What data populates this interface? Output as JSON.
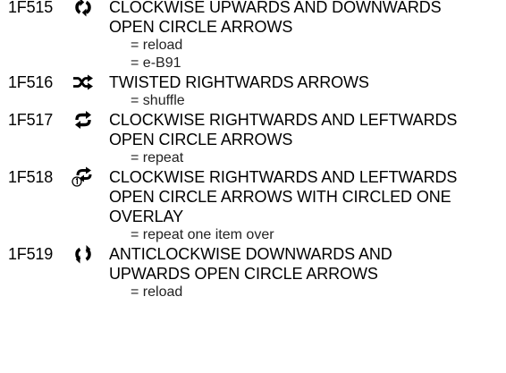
{
  "entries": [
    {
      "code": "1F515",
      "icon": "clockwise-up-down-circle-arrows-icon",
      "name_lines": [
        "CLOCKWISE UPWARDS AND DOWNWARDS",
        "OPEN CIRCLE ARROWS"
      ],
      "notes": [
        "= reload",
        "= e-B91"
      ]
    },
    {
      "code": "1F516",
      "icon": "twisted-rightwards-arrows-icon",
      "name_lines": [
        "TWISTED RIGHTWARDS ARROWS"
      ],
      "notes": [
        "= shuffle"
      ]
    },
    {
      "code": "1F517",
      "icon": "clockwise-right-left-circle-arrows-icon",
      "name_lines": [
        "CLOCKWISE RIGHTWARDS AND LEFTWARDS",
        "OPEN CIRCLE ARROWS"
      ],
      "notes": [
        "= repeat"
      ]
    },
    {
      "code": "1F518",
      "icon": "repeat-one-circle-arrows-icon",
      "name_lines": [
        "CLOCKWISE RIGHTWARDS AND LEFTWARDS",
        "OPEN CIRCLE ARROWS WITH CIRCLED ONE",
        "OVERLAY"
      ],
      "notes": [
        "= repeat one item over"
      ]
    },
    {
      "code": "1F519",
      "icon": "anticlockwise-down-up-circle-arrows-icon",
      "name_lines": [
        "ANTICLOCKWISE DOWNWARDS AND",
        "UPWARDS OPEN CIRCLE ARROWS"
      ],
      "notes": [
        "= reload"
      ]
    }
  ]
}
